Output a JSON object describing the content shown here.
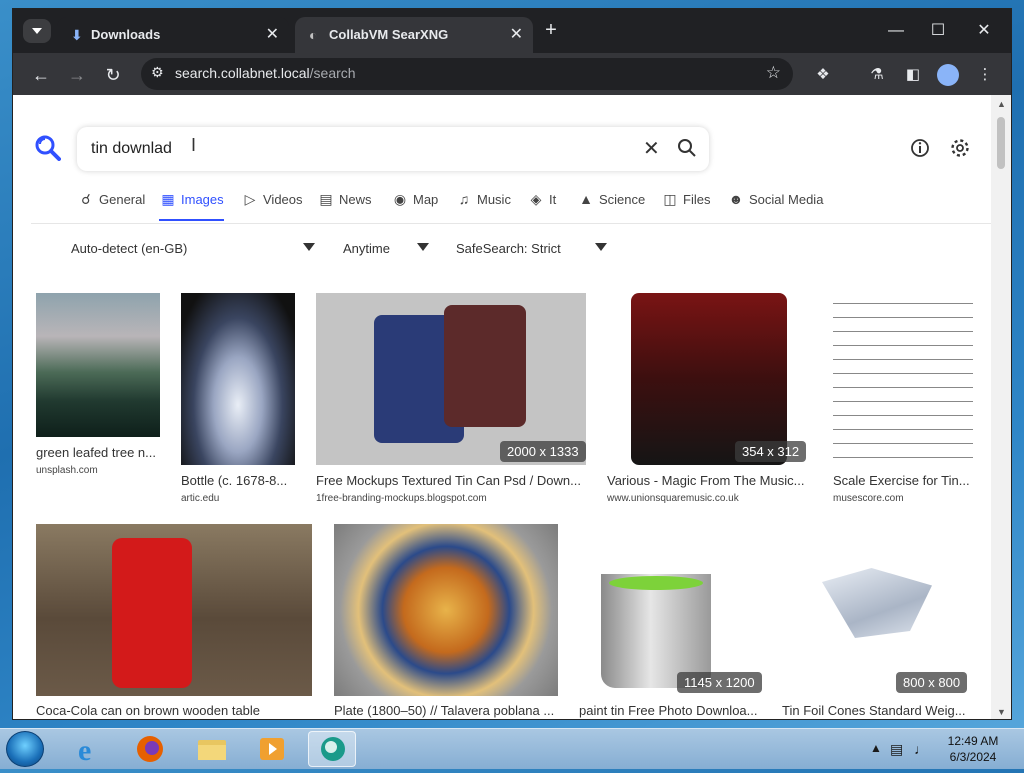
{
  "browser": {
    "tabs": [
      {
        "label": "Downloads",
        "icon": "download-icon"
      },
      {
        "label": "CollabVM SearXNG",
        "icon": "globe-icon"
      }
    ],
    "address": {
      "host": "search.collabnet.local",
      "path": "/search"
    }
  },
  "search": {
    "query": "tin downlad",
    "categories": [
      {
        "label": "General",
        "icon": "search-icon"
      },
      {
        "label": "Images",
        "icon": "image-icon"
      },
      {
        "label": "Videos",
        "icon": "play-icon"
      },
      {
        "label": "News",
        "icon": "newspaper-icon"
      },
      {
        "label": "Map",
        "icon": "map-pin-icon"
      },
      {
        "label": "Music",
        "icon": "music-note-icon"
      },
      {
        "label": "It",
        "icon": "layers-icon"
      },
      {
        "label": "Science",
        "icon": "graduation-cap-icon"
      },
      {
        "label": "Files",
        "icon": "files-icon"
      },
      {
        "label": "Social Media",
        "icon": "people-icon"
      }
    ],
    "active_category": "Images",
    "filters": {
      "language": "Auto-detect (en-GB)",
      "time": "Anytime",
      "safesearch": "SafeSearch: Strict"
    }
  },
  "results": [
    {
      "title": "green leafed tree n...",
      "source": "unsplash.com"
    },
    {
      "title": "Bottle (c. 1678-8...",
      "source": "artic.edu"
    },
    {
      "title": "Free Mockups Textured Tin Can Psd / Down...",
      "source": "1free-branding-mockups.blogspot.com",
      "size": "2000 x 1333"
    },
    {
      "title": "Various - Magic From The Music...",
      "source": "www.unionsquaremusic.co.uk",
      "size": "354 x 312"
    },
    {
      "title": "Scale Exercise for Tin...",
      "source": "musescore.com"
    },
    {
      "title": "Coca-Cola can on brown wooden table"
    },
    {
      "title": "Plate (1800–50) // Talavera poblana ..."
    },
    {
      "title": "paint tin Free Photo Downloa...",
      "size": "1145 x 1200"
    },
    {
      "title": "Tin Foil Cones Standard Weig...",
      "size": "800 x 800"
    }
  ],
  "taskbar": {
    "time": "12:49 AM",
    "date": "6/3/2024"
  }
}
